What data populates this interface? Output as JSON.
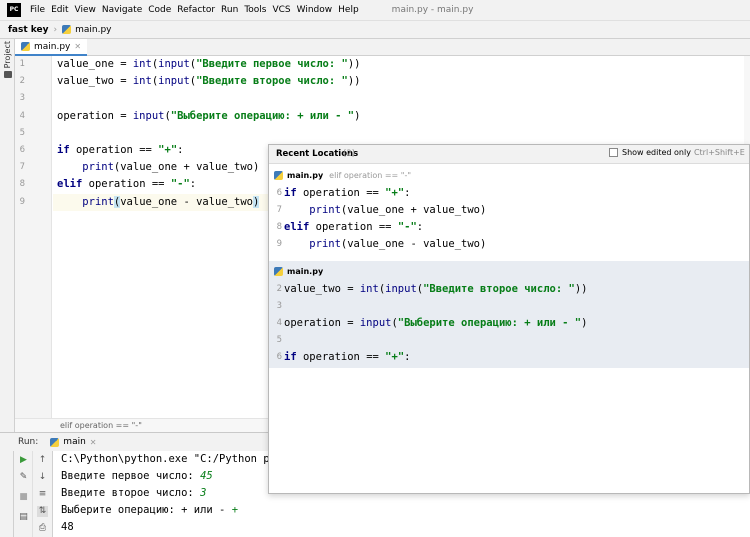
{
  "app": {
    "logo": "PC",
    "window_title": "main.py - main.py"
  },
  "menu": [
    "File",
    "Edit",
    "View",
    "Navigate",
    "Code",
    "Refactor",
    "Run",
    "Tools",
    "VCS",
    "Window",
    "Help"
  ],
  "nav": {
    "project": "fast key",
    "file": "main.py"
  },
  "sidebar": {
    "project_tab": "Project"
  },
  "editor": {
    "tab_label": "main.py",
    "line_numbers": [
      "1",
      "2",
      "3",
      "4",
      "5",
      "6",
      "7",
      "8",
      "9"
    ],
    "lines": [
      {
        "a": "value_one = ",
        "fn": "int",
        "b": "(",
        "fn2": "input",
        "c": "(",
        "str": "\"Введите первое число: \"",
        "d": "))"
      },
      {
        "a": "value_two = ",
        "fn": "int",
        "b": "(",
        "fn2": "input",
        "c": "(",
        "str": "\"Введите второе число: \"",
        "d": "))"
      },
      {
        "a": "operation = ",
        "fn": "input",
        "b": "(",
        "str": "\"Выберите операцию: + или - \"",
        "d": ")"
      },
      {
        "kw": "if",
        "a": " operation == ",
        "str": "\"+\"",
        "d": ":"
      },
      {
        "indent": "    ",
        "fn": "print",
        "b": "(value_one + value_two)"
      },
      {
        "kw": "elif",
        "a": " operation == ",
        "str": "\"-\"",
        "d": ":"
      },
      {
        "indent": "    ",
        "fn": "print",
        "paren": "(",
        "b": "value_one - value_two",
        "paren2": ")"
      }
    ],
    "breadcrumb": "elif operation == \"-\""
  },
  "run": {
    "label": "Run:",
    "tab": "main",
    "console": [
      {
        "text": "C:\\Python\\python.exe \"C:/Python pro"
      },
      {
        "text": "Введите первое число: ",
        "input": "45"
      },
      {
        "text": "Введите второе число: ",
        "input": "3"
      },
      {
        "text": "Выберите операцию: + или - ",
        "input": "+"
      },
      {
        "text": "48"
      }
    ]
  },
  "popup": {
    "title": "Recent Locations",
    "count": "(2)",
    "show_edited_label": "Show edited only",
    "show_edited_shortcut": "Ctrl+Shift+E",
    "locations": [
      {
        "file": "main.py",
        "context": "elif operation == \"-\"",
        "line_numbers": [
          "6",
          "7",
          "8",
          "9"
        ],
        "lines": [
          {
            "kw": "if",
            "a": " operation == ",
            "str": "\"+\"",
            "d": ":"
          },
          {
            "indent": "    ",
            "fn": "print",
            "b": "(value_one + value_two)"
          },
          {
            "kw": "elif",
            "a": " operation == ",
            "str": "\"-\"",
            "d": ":"
          },
          {
            "indent": "    ",
            "fn": "print",
            "b": "(value_one - value_two)"
          }
        ]
      },
      {
        "file": "main.py",
        "context": "",
        "line_numbers": [
          "2",
          "3",
          "4",
          "5",
          "6"
        ],
        "lines": [
          {
            "a": "value_two = ",
            "fn": "int",
            "b": "(",
            "fn2": "input",
            "c": "(",
            "str": "\"Введите второе число: \"",
            "d": "))"
          },
          {
            "a": ""
          },
          {
            "a": "operation = ",
            "fn": "input",
            "b": "(",
            "str": "\"Выберите операцию: + или - \"",
            "d": ")"
          },
          {
            "a": ""
          },
          {
            "kw": "if",
            "a": " operation == ",
            "str": "\"+\"",
            "d": ":"
          }
        ]
      }
    ]
  },
  "colors": {
    "keyword": "#000080",
    "string": "#067d17",
    "caret_row": "#fcfaed",
    "popup_selected": "#e8ecf2",
    "tab_underline": "#4083c9"
  },
  "icons": [
    "run-icon",
    "wrench-icon",
    "stop-icon",
    "up-arrow-icon",
    "down-arrow-icon",
    "wrap-icon",
    "sort-icon",
    "print-icon",
    "python-file-icon",
    "close-icon"
  ]
}
